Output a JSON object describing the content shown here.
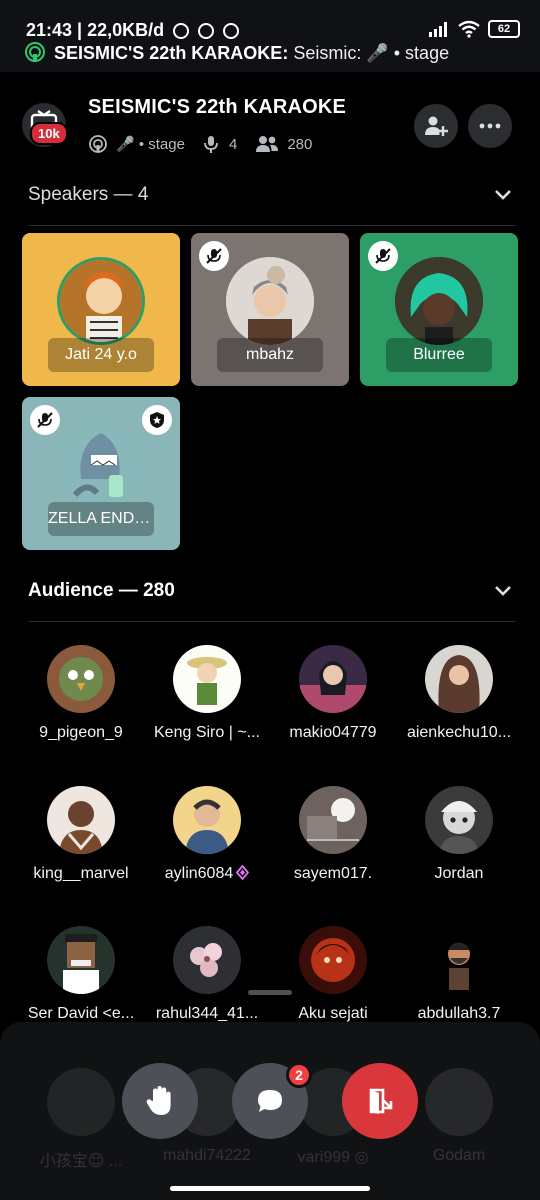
{
  "status_bar": {
    "time": "21:43 | 22,0KB/d",
    "battery": "62",
    "ongoing_title": "SEISMIC'S 22th KARAOKE:",
    "ongoing_rest": "Seismic: 🎤 • stage"
  },
  "header": {
    "title": "SEISMIC'S 22th KARAOKE",
    "badge": "10k",
    "stage_label": "🎤 • stage",
    "speaker_count": "4",
    "listener_count": "280"
  },
  "speakers": {
    "heading": "Speakers — 4",
    "tiles": [
      {
        "name": "Jati 24 y.o",
        "color": "#f0b84a"
      },
      {
        "name": "mbahz",
        "color": "#7b7470"
      },
      {
        "name": "Blurree",
        "color": "#2d9e66"
      },
      {
        "name": "ZELLA ENDU...",
        "color": "#8bb6b8"
      }
    ]
  },
  "audience": {
    "heading": "Audience — 280",
    "members": [
      {
        "name": "9_pigeon_9"
      },
      {
        "name": "Keng Siro | ~..."
      },
      {
        "name": "makio04779"
      },
      {
        "name": "aienkechu10..."
      },
      {
        "name": "king__marvel"
      },
      {
        "name": "aylin6084"
      },
      {
        "name": "sayem017."
      },
      {
        "name": "Jordan"
      },
      {
        "name": "Ser David <e..."
      },
      {
        "name": "rahul344_41..."
      },
      {
        "name": "Aku sejati"
      },
      {
        "name": "abdullah3.7"
      }
    ],
    "ghost_members": [
      {
        "name": "小孩宝😊 ..."
      },
      {
        "name": "mahdi74222"
      },
      {
        "name": "vari999 ◎"
      },
      {
        "name": "Godam"
      }
    ]
  },
  "controls": {
    "chat_badge": "2"
  }
}
